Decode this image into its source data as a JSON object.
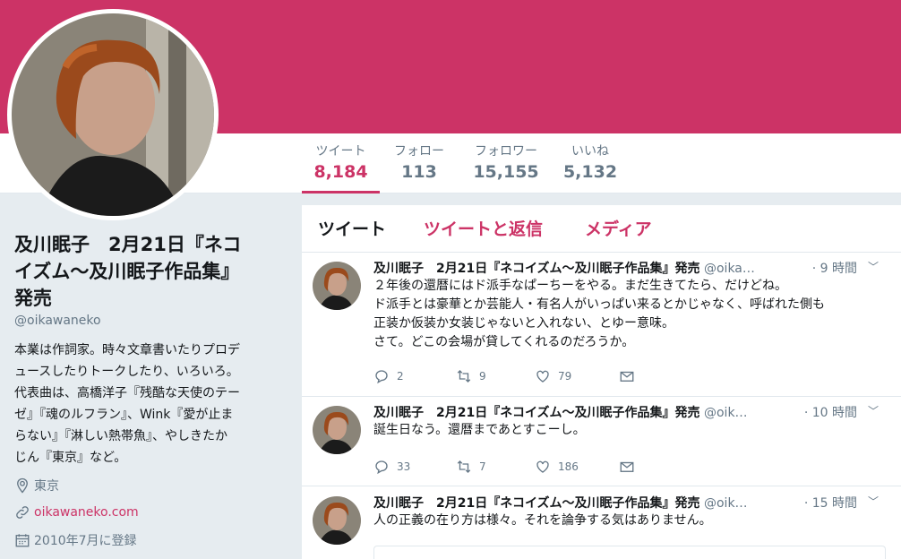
{
  "colors": {
    "accent": "#cc3366",
    "banner": "#cc3366",
    "muted": "#657786"
  },
  "stats": [
    {
      "label": "ツイート",
      "value": "8,184",
      "active": true
    },
    {
      "label": "フォロー",
      "value": "113"
    },
    {
      "label": "フォロワー",
      "value": "15,155"
    },
    {
      "label": "いいね",
      "value": "5,132"
    }
  ],
  "profile": {
    "name_line1": "及川眠子　2月21日『ネコ",
    "name_line2": "イズム〜及川眠子作品集』",
    "name_line3": "発売",
    "handle": "@oikawaneko",
    "bio": [
      "本業は作詞家。時々文章書いたりプロデ",
      "ュースしたりトークしたり、いろいろ。",
      "代表曲は、高橋洋子『残酷な天使のテー",
      "ゼ』『魂のルフラン』、Wink『愛が止ま",
      "らない』『淋しい熱帯魚』、やしきたか",
      "じん『東京』など。"
    ],
    "location": "東京",
    "website": "oikawaneko.com",
    "joined": "2010年7月に登録"
  },
  "tabs": {
    "tweets": "ツイート",
    "replies": "ツイートと返信",
    "media": "メディア"
  },
  "tweets": [
    {
      "name": "及川眠子　2月21日『ネコイズム〜及川眠子作品集』発売",
      "handle": "@oika…",
      "time": "· 9 時間",
      "lines": [
        "２年後の還暦にはド派手なぱーちーをやる。まだ生きてたら、だけどね。",
        "ド派手とは豪華とか芸能人・有名人がいっぱい来るとかじゃなく、呼ばれた側も",
        "正装か仮装か女装じゃないと入れない、とゆー意味。",
        "さて。どこの会場が貸してくれるのだろうか。"
      ],
      "replies": "2",
      "retweets": "9",
      "likes": "79"
    },
    {
      "name": "及川眠子　2月21日『ネコイズム〜及川眠子作品集』発売",
      "handle": "@oik…",
      "time": "· 10 時間",
      "lines": [
        "誕生日なう。還暦まであとすこーし。"
      ],
      "replies": "33",
      "retweets": "7",
      "likes": "186"
    },
    {
      "name": "及川眠子　2月21日『ネコイズム〜及川眠子作品集』発売",
      "handle": "@oik…",
      "time": "· 15 時間",
      "lines": [
        "人の正義の在り方は様々。それを論争する気はありません。"
      ]
    }
  ]
}
